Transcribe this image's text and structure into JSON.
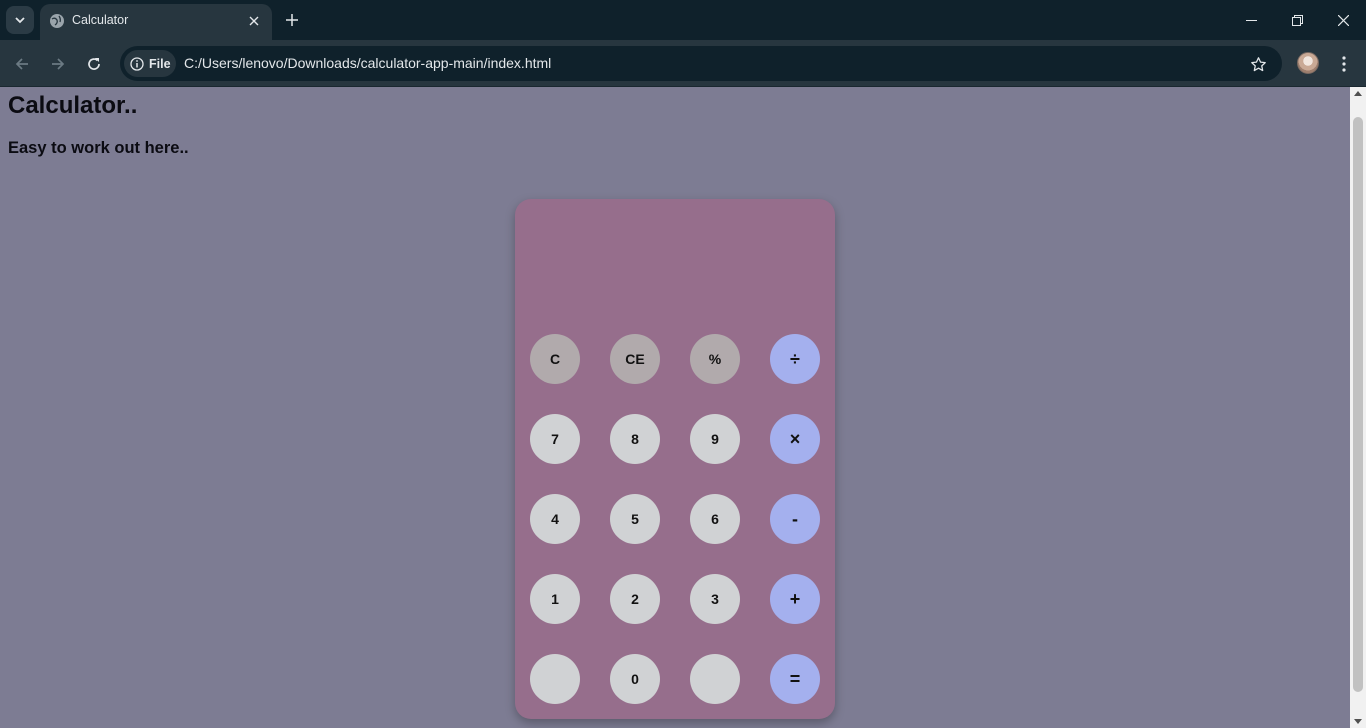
{
  "browser": {
    "tab": {
      "title": "Calculator"
    },
    "address_bar": {
      "chip_label": "File",
      "url": "C:/Users/lenovo/Downloads/calculator-app-main/index.html"
    }
  },
  "page": {
    "title": "Calculator..",
    "subtitle": "Easy to work out here.."
  },
  "calculator": {
    "display": "",
    "buttons": [
      "C",
      "CE",
      "%",
      "÷",
      "7",
      "8",
      "9",
      "×",
      "4",
      "5",
      "6",
      "-",
      "1",
      "2",
      "3",
      "+",
      "",
      "0",
      "",
      "="
    ],
    "colors": {
      "body": "#966e8c",
      "function_keys": "#b1aaac",
      "number_keys": "#d0d2d4",
      "operator_keys": "#a4b0ee",
      "page_background": "#7d7c93"
    }
  }
}
